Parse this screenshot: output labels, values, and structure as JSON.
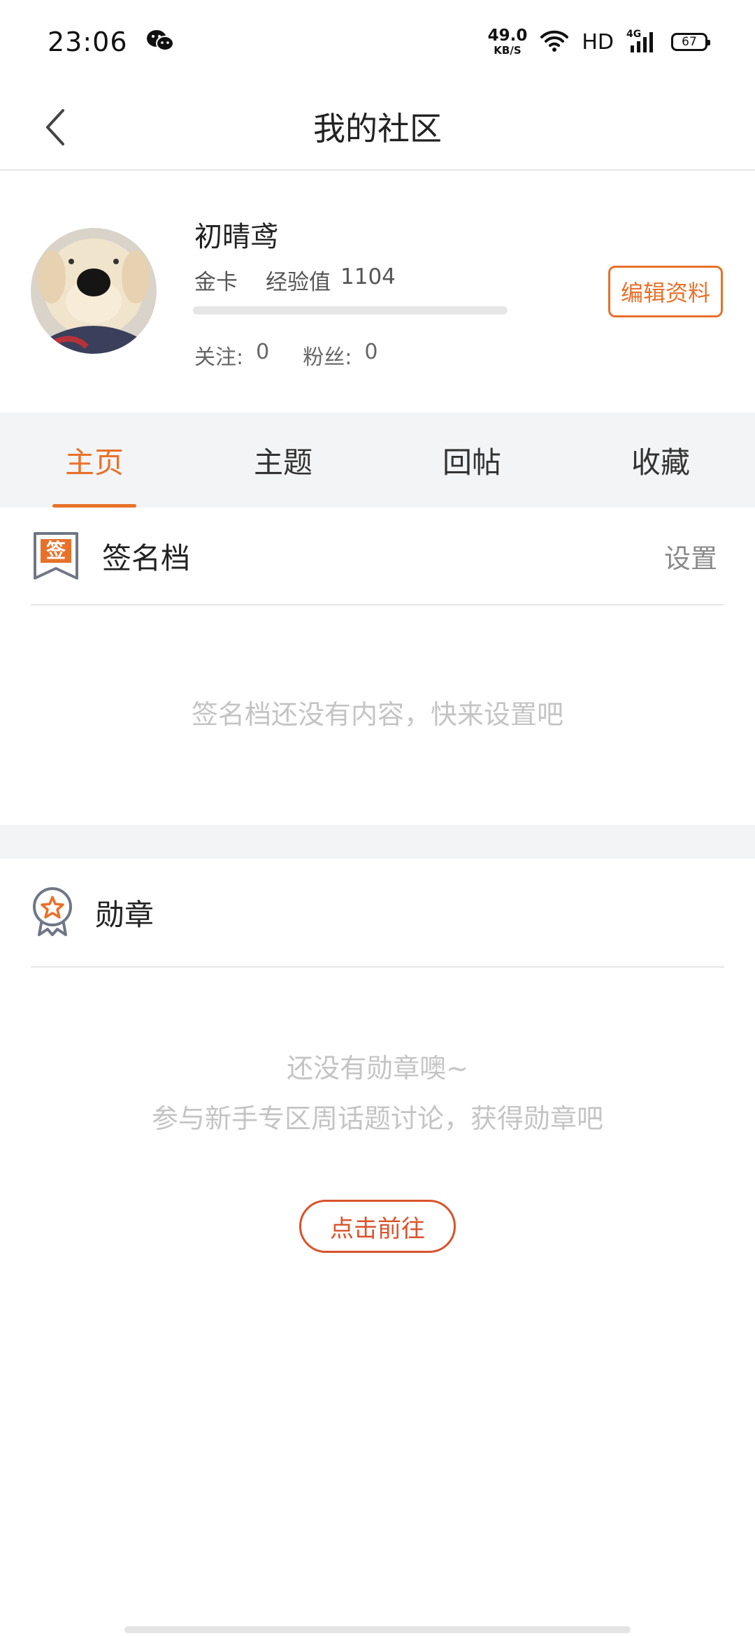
{
  "status_bar": {
    "time": "23:06",
    "net_speed_value": "49.0",
    "net_speed_unit": "KB/S",
    "hd": "HD",
    "network": "4G",
    "battery": "67"
  },
  "nav": {
    "title": "我的社区"
  },
  "profile": {
    "username": "初晴鸢",
    "level": "金卡",
    "exp_label": "经验值",
    "exp_value": "1104",
    "exp_progress": 0.0,
    "follow_label": "关注:",
    "follow_count": "0",
    "fans_label": "粉丝:",
    "fans_count": "0",
    "edit_label": "编辑资料"
  },
  "tabs": [
    {
      "label": "主页",
      "active": true
    },
    {
      "label": "主题",
      "active": false
    },
    {
      "label": "回帖",
      "active": false
    },
    {
      "label": "收藏",
      "active": false
    }
  ],
  "signature": {
    "icon_char": "签",
    "title": "签名档",
    "action": "设置",
    "empty": "签名档还没有内容，快来设置吧"
  },
  "medals": {
    "title": "勋章",
    "empty_line1": "还没有勋章噢~",
    "empty_line2": "参与新手专区周话题讨论，获得勋章吧",
    "button": "点击前往"
  },
  "colors": {
    "accent": "#e8712a",
    "button_red": "#d9532c",
    "band": "#f3f4f6"
  }
}
